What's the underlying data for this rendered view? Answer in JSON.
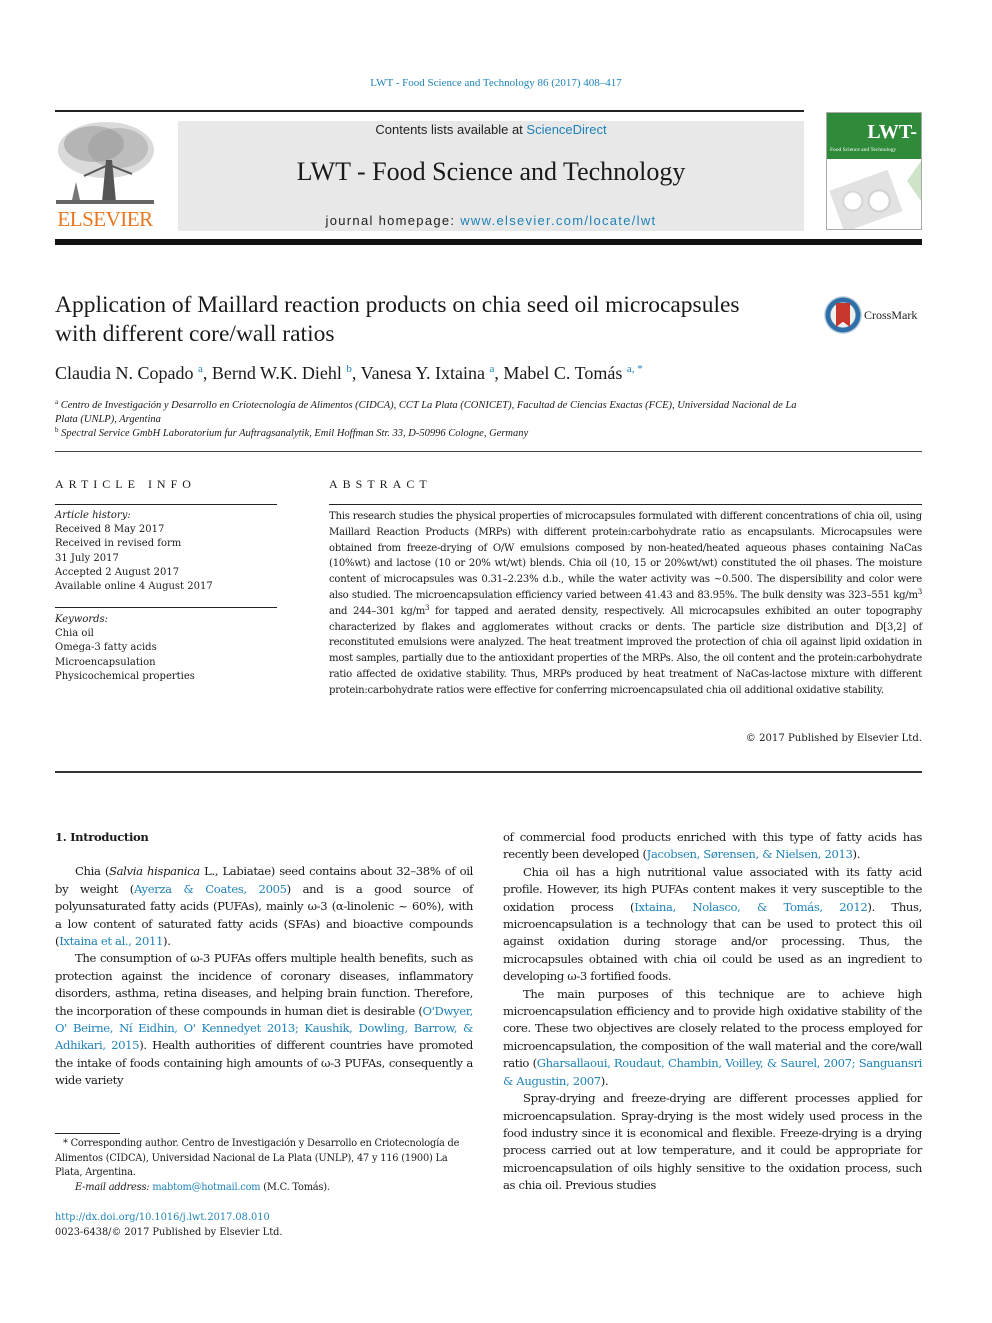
{
  "header": {
    "journal_ref": "LWT - Food Science and Technology 86 (2017) 408–417",
    "contents_prefix": "Contents lists available at ",
    "contents_link": "ScienceDirect",
    "journal_title": "LWT - Food Science and Technology",
    "homepage_prefix": "journal homepage: ",
    "homepage_link": "www.elsevier.com/locate/lwt",
    "publisher_logo_text": "ELSEVIER",
    "cover_title": "LWT-",
    "cover_subtitle": "Food Science and Technology"
  },
  "article": {
    "title": "Application of Maillard reaction products on chia seed oil microcapsules with different core/wall ratios",
    "crossmark_label": "CrossMark",
    "authors": [
      {
        "name": "Claudia N. Copado",
        "aff": "a"
      },
      {
        "name": "Bernd W.K. Diehl",
        "aff": "b"
      },
      {
        "name": "Vanesa Y. Ixtaina",
        "aff": "a"
      },
      {
        "name": "Mabel C. Tomás",
        "aff": "a, *"
      }
    ],
    "affiliations": [
      {
        "key": "a",
        "text": "Centro de Investigación y Desarrollo en Criotecnología de Alimentos (CIDCA), CCT La Plata (CONICET), Facultad de Ciencias Exactas (FCE), Universidad Nacional de La Plata (UNLP), Argentina"
      },
      {
        "key": "b",
        "text": "Spectral Service GmbH Laboratorium fur Auftragsanalytik, Emil Hoffman Str. 33, D-50996 Cologne, Germany"
      }
    ]
  },
  "article_info": {
    "heading": "ARTICLE INFO",
    "history_label": "Article history:",
    "history": [
      "Received 8 May 2017",
      "Received in revised form",
      "31 July 2017",
      "Accepted 2 August 2017",
      "Available online 4 August 2017"
    ],
    "keywords_label": "Keywords:",
    "keywords": [
      "Chia oil",
      "Omega-3 fatty acids",
      "Microencapsulation",
      "Physicochemical properties"
    ]
  },
  "abstract": {
    "heading": "ABSTRACT",
    "part1": "This research studies the physical properties of microcapsules formulated with different concentrations of chia oil, using Maillard Reaction Products (MRPs) with different protein:carbohydrate ratio as encapsulants. Microcapsules were obtained from freeze-drying of O/W emulsions composed by non-heated/heated aqueous phases containing NaCas (10%wt) and lactose (10 or 20% wt/wt) blends. Chia oil (10, 15 or 20%wt/wt) constituted the oil phases. The moisture content of microcapsules was 0.31–2.23% d.b., while the water activity was ~0.500. The dispersibility and color were also studied. The microencapsulation efficiency varied between 41.43 and 83.95%. The bulk density was 323–551 kg/m",
    "sup1": "3",
    "part2": " and 244–301 kg/m",
    "sup2": "3",
    "part3": " for tapped and aerated density, respectively. All microcapsules exhibited an outer topography characterized by flakes and agglomerates without cracks or dents. The particle size distribution and D[3,2] of reconstituted emulsions were analyzed. The heat treatment improved the protection of chia oil against lipid oxidation in most samples, partially due to the antioxidant properties of the MRPs. Also, the oil content and the protein:carbohydrate ratio affected de oxidative stability. Thus, MRPs produced by heat treatment of NaCas-lactose mixture with different protein:carbohydrate ratios were effective for conferring microencapsulated chia oil additional oxidative stability.",
    "copyright": "© 2017 Published by Elsevier Ltd."
  },
  "introduction": {
    "heading": "1.  Introduction",
    "p1": {
      "a": "Chia (",
      "italic": "Salvia hispanica",
      "b": " L., Labiatae) seed contains about 32–38% of oil by weight (",
      "ref1": "Ayerza & Coates, 2005",
      "c": ") and is a good source of polyunsaturated fatty acids (PUFAs), mainly ω-3 (α-linolenic ~ 60%), with a low content of saturated fatty acids (SFAs) and bioactive compounds (",
      "ref2": "Ixtaina et al., 2011",
      "d": ")."
    },
    "p2": {
      "a": "The consumption of ω-3 PUFAs offers multiple health benefits, such as protection against the incidence of coronary diseases, inflammatory disorders, asthma, retina diseases, and helping brain function. Therefore, the incorporation of these compounds in human diet is desirable (",
      "ref1": "O'Dwyer, O' Beirne, Ní Eidhin, O' Kennedyet 2013; Kaushik, Dowling, Barrow, & Adhikari, 2015",
      "b": "). Health authorities of different countries have promoted the intake of foods containing high amounts of ω-3 PUFAs, consequently a wide variety"
    },
    "p2_cont": {
      "a": "of commercial food products enriched with this type of fatty acids has recently been developed (",
      "ref1": "Jacobsen, Sørensen, & Nielsen, 2013",
      "b": ")."
    },
    "p3": {
      "a": "Chia oil has a high nutritional value associated with its fatty acid profile. However, its high PUFAs content makes it very susceptible to the oxidation process (",
      "ref1": "Ixtaina, Nolasco, & Tomás, 2012",
      "b": "). Thus, microencapsulation is a technology that can be used to protect this oil against oxidation during storage and/or processing. Thus, the microcapsules obtained with chia oil could be used as an ingredient to developing ω-3 fortified foods."
    },
    "p4": {
      "a": "The main purposes of this technique are to achieve high microencapsulation efficiency and to provide high oxidative stability of the core. These two objectives are closely related to the process employed for microencapsulation, the composition of the wall material and the core/wall ratio (",
      "ref1": "Gharsallaoui, Roudaut, Chambin, Voilley, & Saurel, 2007; Sanguansri & Augustin, 2007",
      "b": ")."
    },
    "p5": "Spray-drying and freeze-drying are different processes applied for microencapsulation. Spray-drying is the most widely used process in the food industry since it is economical and flexible. Freeze-drying is a drying process carried out at low temperature, and it could be appropriate for microencapsulation of oils highly sensitive to the oxidation process, such as chia oil. Previous studies"
  },
  "footnote": {
    "corresponding": "* Corresponding author. Centro de Investigación y Desarrollo en Criotecnología de Alimentos (CIDCA), Universidad Nacional de La Plata (UNLP), 47 y 116 (1900) La Plata, Argentina.",
    "email_label": "E-mail address:",
    "email": "mabtom@hotmail.com",
    "email_suffix": " (M.C. Tomás).",
    "doi": "http://dx.doi.org/10.1016/j.lwt.2017.08.010",
    "issn": "0023-6438/© 2017 Published by Elsevier Ltd."
  }
}
